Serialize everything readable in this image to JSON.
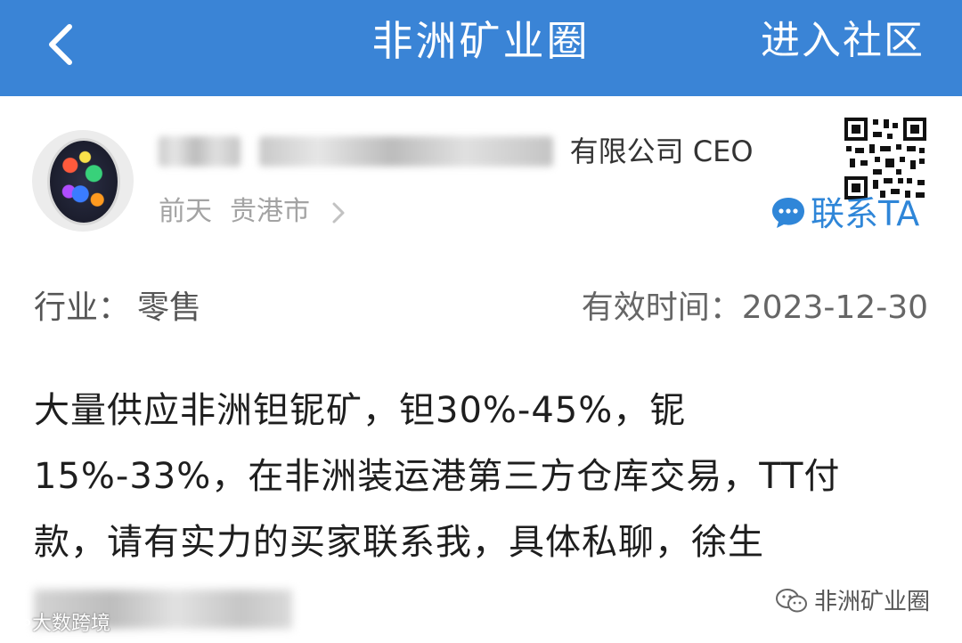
{
  "header": {
    "title": "非洲矿业圈",
    "community_label": "进入社区",
    "background_color": "#3a84d6"
  },
  "poster": {
    "name_visible": "徐杰",
    "title_suffix": "有限公司 CEO",
    "time": "前天",
    "location": "贵港市",
    "contact_label": "联系TA",
    "accent_color": "#2f86d8"
  },
  "info": {
    "industry_label": "行业：",
    "industry_value": "零售",
    "validity_label": "有效时间：",
    "validity_value": "2023-12-30"
  },
  "post": {
    "lines": [
      "大量供应非洲钽铌矿，钽30%-45%，铌",
      "15%-33%，在非洲装运港第三方仓库交易，TT付",
      "款，请有实力的买家联系我，具体私聊，徐生"
    ]
  },
  "watermarks": {
    "right": "非洲矿业圈",
    "left": "大数跨境"
  }
}
